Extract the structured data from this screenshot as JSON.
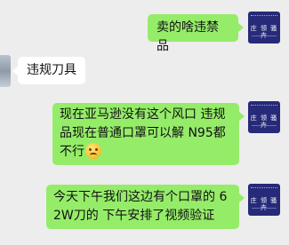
{
  "chat": {
    "messages": [
      {
        "sender": "self",
        "text": "卖的啥违禁品"
      },
      {
        "sender": "other",
        "text": "违规刀具"
      },
      {
        "sender": "self",
        "text": "现在亚马逊没有这个风口  违规品现在普通口罩可以解  N95都不行",
        "emoji": "flushed-face-icon"
      },
      {
        "sender": "self",
        "text": "今天下午我们这边有个口罩的  62W刀的  下午安排了视频验证"
      }
    ],
    "self_avatar_text": "庄 领 骚 卉"
  },
  "colors": {
    "outgoing_bubble": "#95ec69",
    "incoming_bubble": "#ffffff",
    "background": "#ededed",
    "avatar_bg": "#262a78"
  }
}
